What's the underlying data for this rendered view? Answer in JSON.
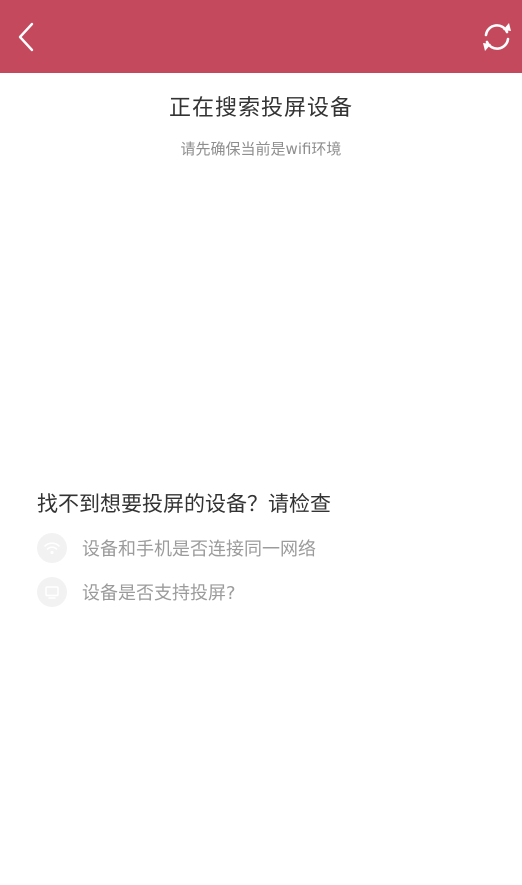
{
  "header": {
    "back_icon": "chevron-left-icon",
    "refresh_icon": "refresh-icon",
    "color": "#c4495d"
  },
  "main": {
    "title": "正在搜索投屏设备",
    "subtitle": "请先确保当前是wifi环境"
  },
  "help": {
    "title": "找不到想要投屏的设备？请检查",
    "items": [
      {
        "icon": "wifi-icon",
        "label": "设备和手机是否连接同一网络"
      },
      {
        "icon": "tv-icon",
        "label": "设备是否支持投屏?"
      }
    ]
  }
}
